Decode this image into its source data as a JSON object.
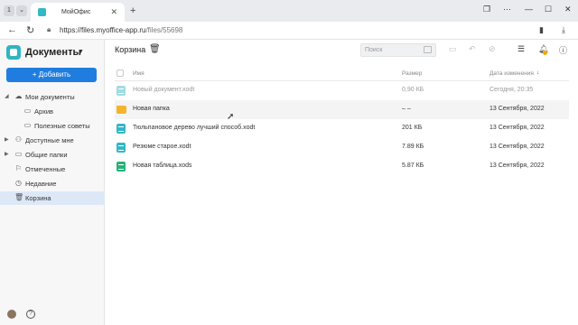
{
  "browser": {
    "tab_counter": "1",
    "tab_title": "МойОфис",
    "url_host": "https://files.myoffice-app.ru",
    "url_path": "/files/55698"
  },
  "sidebar": {
    "app_title": "Документы",
    "add_button": "+ Добавить",
    "items": [
      {
        "label": "Мои документы",
        "icon": "cloud-icon"
      },
      {
        "label": "Архив",
        "icon": "folder-icon"
      },
      {
        "label": "Полезные советы",
        "icon": "folder-icon"
      },
      {
        "label": "Доступные мне",
        "icon": "users-icon"
      },
      {
        "label": "Общие папки",
        "icon": "shared-folder-icon"
      },
      {
        "label": "Отмеченные",
        "icon": "flag-icon"
      },
      {
        "label": "Недавние",
        "icon": "clock-icon"
      },
      {
        "label": "Корзина",
        "icon": "trash-icon"
      }
    ]
  },
  "main": {
    "title": "Корзина",
    "search_placeholder": "Поиск",
    "columns": {
      "name": "Имя",
      "size": "Размер",
      "date": "Дата изменения"
    },
    "files": [
      {
        "name": "Новый документ.xodt",
        "size": "0,90 КБ",
        "date": "Сегодня, 20:35",
        "kind": "doc",
        "dim": true
      },
      {
        "name": "Новая папка",
        "size": "– –",
        "date": "13 Сентября, 2022",
        "kind": "folder"
      },
      {
        "name": "Тюльпановое дерево лучший способ.xodt",
        "size": "201 КБ",
        "date": "13 Сентября, 2022",
        "kind": "doc"
      },
      {
        "name": "Резюме старое.xodt",
        "size": "7.89 КБ",
        "date": "13 Сентября, 2022",
        "kind": "doc"
      },
      {
        "name": "Новая таблица.xods",
        "size": "5.87 КБ",
        "date": "13 Сентября, 2022",
        "kind": "sheet"
      }
    ]
  },
  "colors": {
    "accent": "#1f7de0",
    "doc": "#33b7c8",
    "folder": "#f5b52b",
    "sheet": "#26b276"
  }
}
